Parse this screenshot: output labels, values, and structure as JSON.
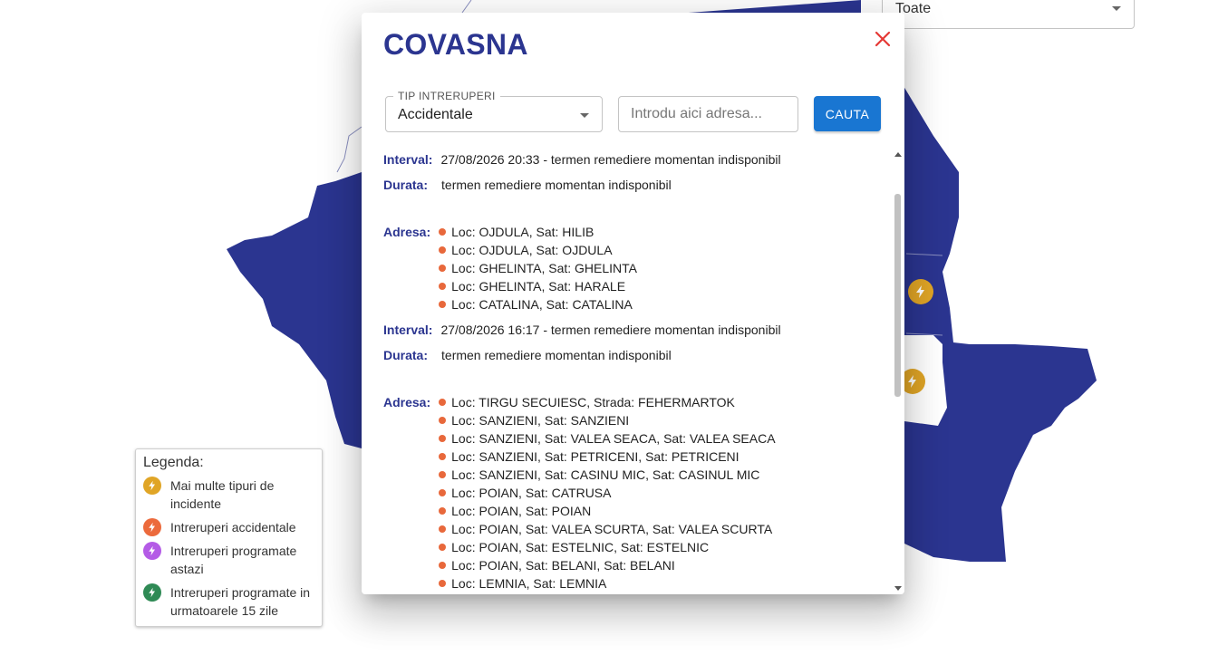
{
  "colors": {
    "map_fill": "#2b3590",
    "title": "#2b3590",
    "accent_button": "#1976d2",
    "close": "#e53935",
    "bullet": "#e8683b",
    "multi_incident": "#e0a526",
    "accidental": "#ec6a3c",
    "planned_today": "#b45be6",
    "planned_15": "#2f8a55"
  },
  "top_filter": {
    "value": "Toate"
  },
  "modal": {
    "title": "COVASNA",
    "close_icon": "close-icon",
    "filter_label": "TIP INTRERUPERI",
    "filter_value": "Accidentale",
    "address_placeholder": "Introdu aici adresa...",
    "search_label": "CAUTA"
  },
  "labels": {
    "interval": "Interval:",
    "durata": "Durata:",
    "adresa": "Adresa:"
  },
  "records": [
    {
      "interval": "27/08/2026 20:33 - termen remediere momentan indisponibil",
      "durata": "termen remediere momentan indisponibil",
      "addresses": [
        "Loc: OJDULA, Sat: HILIB",
        "Loc: OJDULA, Sat: OJDULA",
        "Loc: GHELINTA, Sat: GHELINTA",
        "Loc: GHELINTA, Sat: HARALE",
        "Loc: CATALINA, Sat: CATALINA"
      ]
    },
    {
      "interval": "27/08/2026 16:17 - termen remediere momentan indisponibil",
      "durata": "termen remediere momentan indisponibil",
      "addresses": [
        "Loc: TIRGU SECUIESC, Strada: FEHERMARTOK",
        "Loc: SANZIENI, Sat: SANZIENI",
        "Loc: SANZIENI, Sat: VALEA SEACA, Sat: VALEA SEACA",
        "Loc: SANZIENI, Sat: PETRICENI, Sat: PETRICENI",
        "Loc: SANZIENI, Sat: CASINU MIC, Sat: CASINUL MIC",
        "Loc: POIAN, Sat: CATRUSA",
        "Loc: POIAN, Sat: POIAN",
        "Loc: POIAN, Sat: VALEA SCURTA, Sat: VALEA SCURTA",
        "Loc: POIAN, Sat: ESTELNIC, Sat: ESTELNIC",
        "Loc: POIAN, Sat: BELANI, Sat: BELANI",
        "Loc: LEMNIA, Sat: LEMNIA"
      ]
    }
  ],
  "legend": {
    "title": "Legenda:",
    "items": [
      {
        "label": "Mai multe tipuri de incidente",
        "color": "#e0a526",
        "icon": "lightning-icon"
      },
      {
        "label": "Intreruperi accidentale",
        "color": "#ec6a3c",
        "icon": "lightning-icon"
      },
      {
        "label": "Intreruperi programate astazi",
        "color": "#b45be6",
        "icon": "lightning-icon"
      },
      {
        "label": "Intreruperi programate in urmatoarele 15 zile",
        "color": "#2f8a55",
        "icon": "lightning-icon"
      }
    ]
  }
}
